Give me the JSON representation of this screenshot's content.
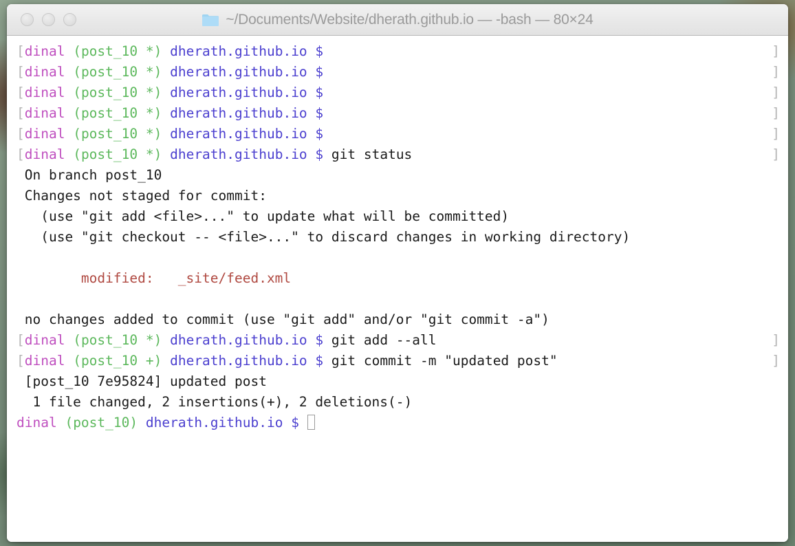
{
  "window": {
    "title": "~/Documents/Website/dherath.github.io — -bash — 80×24",
    "folder_icon": "folder-icon",
    "traffic_lights": [
      {
        "name": "close",
        "label": ""
      },
      {
        "name": "minimize",
        "label": ""
      },
      {
        "name": "zoom",
        "label": ""
      }
    ]
  },
  "colors": {
    "desktop": "#7f9480",
    "titlebar": "#eaeaea",
    "title_text": "#9a9a9a",
    "terminal_bg": "#ffffff",
    "text": "#1a1a1a",
    "bracket": "#b4b4b4",
    "user": "#bf4fbf",
    "branch": "#5cb85c",
    "host": "#4b3fcf",
    "modified": "#b04a42",
    "cursor": "#9a9a9a"
  },
  "prompt": {
    "open_bracket": "[",
    "close_bracket": "]",
    "user": "dinal",
    "branch_dirty": "(post_10 *)",
    "branch_staged": "(post_10 +)",
    "branch_clean": "(post_10)",
    "host": "dherath.github.io",
    "sigil": "$"
  },
  "lines": [
    {
      "type": "prompt",
      "branch": "(post_10 *)",
      "command": "",
      "bracketed": true
    },
    {
      "type": "prompt",
      "branch": "(post_10 *)",
      "command": "",
      "bracketed": true
    },
    {
      "type": "prompt",
      "branch": "(post_10 *)",
      "command": "",
      "bracketed": true
    },
    {
      "type": "prompt",
      "branch": "(post_10 *)",
      "command": "",
      "bracketed": true
    },
    {
      "type": "prompt",
      "branch": "(post_10 *)",
      "command": "",
      "bracketed": true
    },
    {
      "type": "prompt",
      "branch": "(post_10 *)",
      "command": " git status",
      "bracketed": true
    },
    {
      "type": "output",
      "text": " On branch post_10"
    },
    {
      "type": "output",
      "text": " Changes not staged for commit:"
    },
    {
      "type": "output",
      "text": "   (use \"git add <file>...\" to update what will be committed)"
    },
    {
      "type": "output",
      "text": "   (use \"git checkout -- <file>...\" to discard changes in working directory)"
    },
    {
      "type": "output",
      "text": ""
    },
    {
      "type": "modified",
      "text": "        modified:   _site/feed.xml"
    },
    {
      "type": "output",
      "text": ""
    },
    {
      "type": "output",
      "text": " no changes added to commit (use \"git add\" and/or \"git commit -a\")"
    },
    {
      "type": "prompt",
      "branch": "(post_10 *)",
      "command": " git add --all",
      "bracketed": true
    },
    {
      "type": "prompt",
      "branch": "(post_10 +)",
      "command": " git commit -m \"updated post\"",
      "bracketed": true
    },
    {
      "type": "output",
      "text": " [post_10 7e95824] updated post"
    },
    {
      "type": "output",
      "text": "  1 file changed, 2 insertions(+), 2 deletions(-)"
    },
    {
      "type": "prompt_cursor",
      "branch": "(post_10)",
      "command": " ",
      "bracketed": false
    }
  ]
}
